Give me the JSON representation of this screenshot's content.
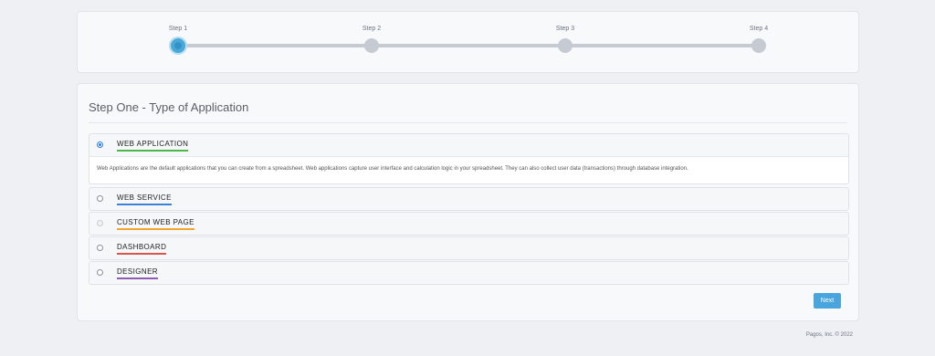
{
  "stepper": {
    "steps": [
      {
        "label": "Step 1",
        "state": "active"
      },
      {
        "label": "Step 2",
        "state": "inactive"
      },
      {
        "label": "Step 3",
        "state": "inactive"
      },
      {
        "label": "Step 4",
        "state": "inactive"
      }
    ]
  },
  "main": {
    "title": "Step One - Type of Application",
    "options": [
      {
        "label": "WEB APPLICATION",
        "selected": true,
        "underline_color": "#4cb84a",
        "description": "Web Applications are the default applications that you can create from a spreadsheet. Web applications capture user interface and calculation logic in your spreadsheet. They can also collect user data (transactions) through database integration."
      },
      {
        "label": "WEB SERVICE",
        "selected": false,
        "underline_color": "#3b82d6"
      },
      {
        "label": "CUSTOM WEB PAGE",
        "selected": false,
        "disabled": true,
        "underline_color": "#f0a630"
      },
      {
        "label": "DASHBOARD",
        "selected": false,
        "underline_color": "#d9534f"
      },
      {
        "label": "DESIGNER",
        "selected": false,
        "underline_color": "#8e5bb5"
      }
    ],
    "next_label": "Next"
  },
  "footer": {
    "copyright": "Pagos, Inc. © 2022"
  },
  "colors": {
    "accent": "#4aa4de",
    "active_step": "#4aa8d8",
    "inactive_step": "#c6cad3"
  }
}
